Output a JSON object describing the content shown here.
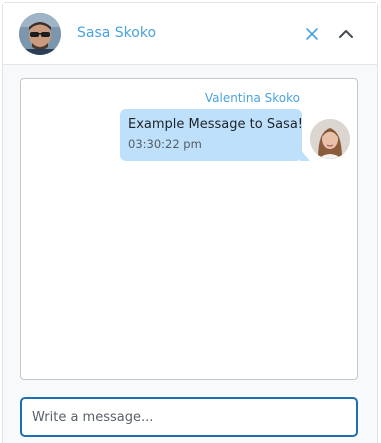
{
  "header": {
    "contact_name": "Sasa Skoko",
    "avatar_icon": "user-photo-man-sunglasses",
    "close_icon": "close-icon",
    "collapse_icon": "chevron-up-icon"
  },
  "messages": [
    {
      "sender": "Valentina Skoko",
      "text": "Example Message to Sasa!",
      "time": "03:30:22 pm",
      "avatar_icon": "user-photo-woman"
    }
  ],
  "composer": {
    "placeholder": "Write a message..."
  },
  "colors": {
    "accent": "#4aa3df",
    "bubble": "#bfe0fa",
    "input_border": "#1f6fb0"
  }
}
